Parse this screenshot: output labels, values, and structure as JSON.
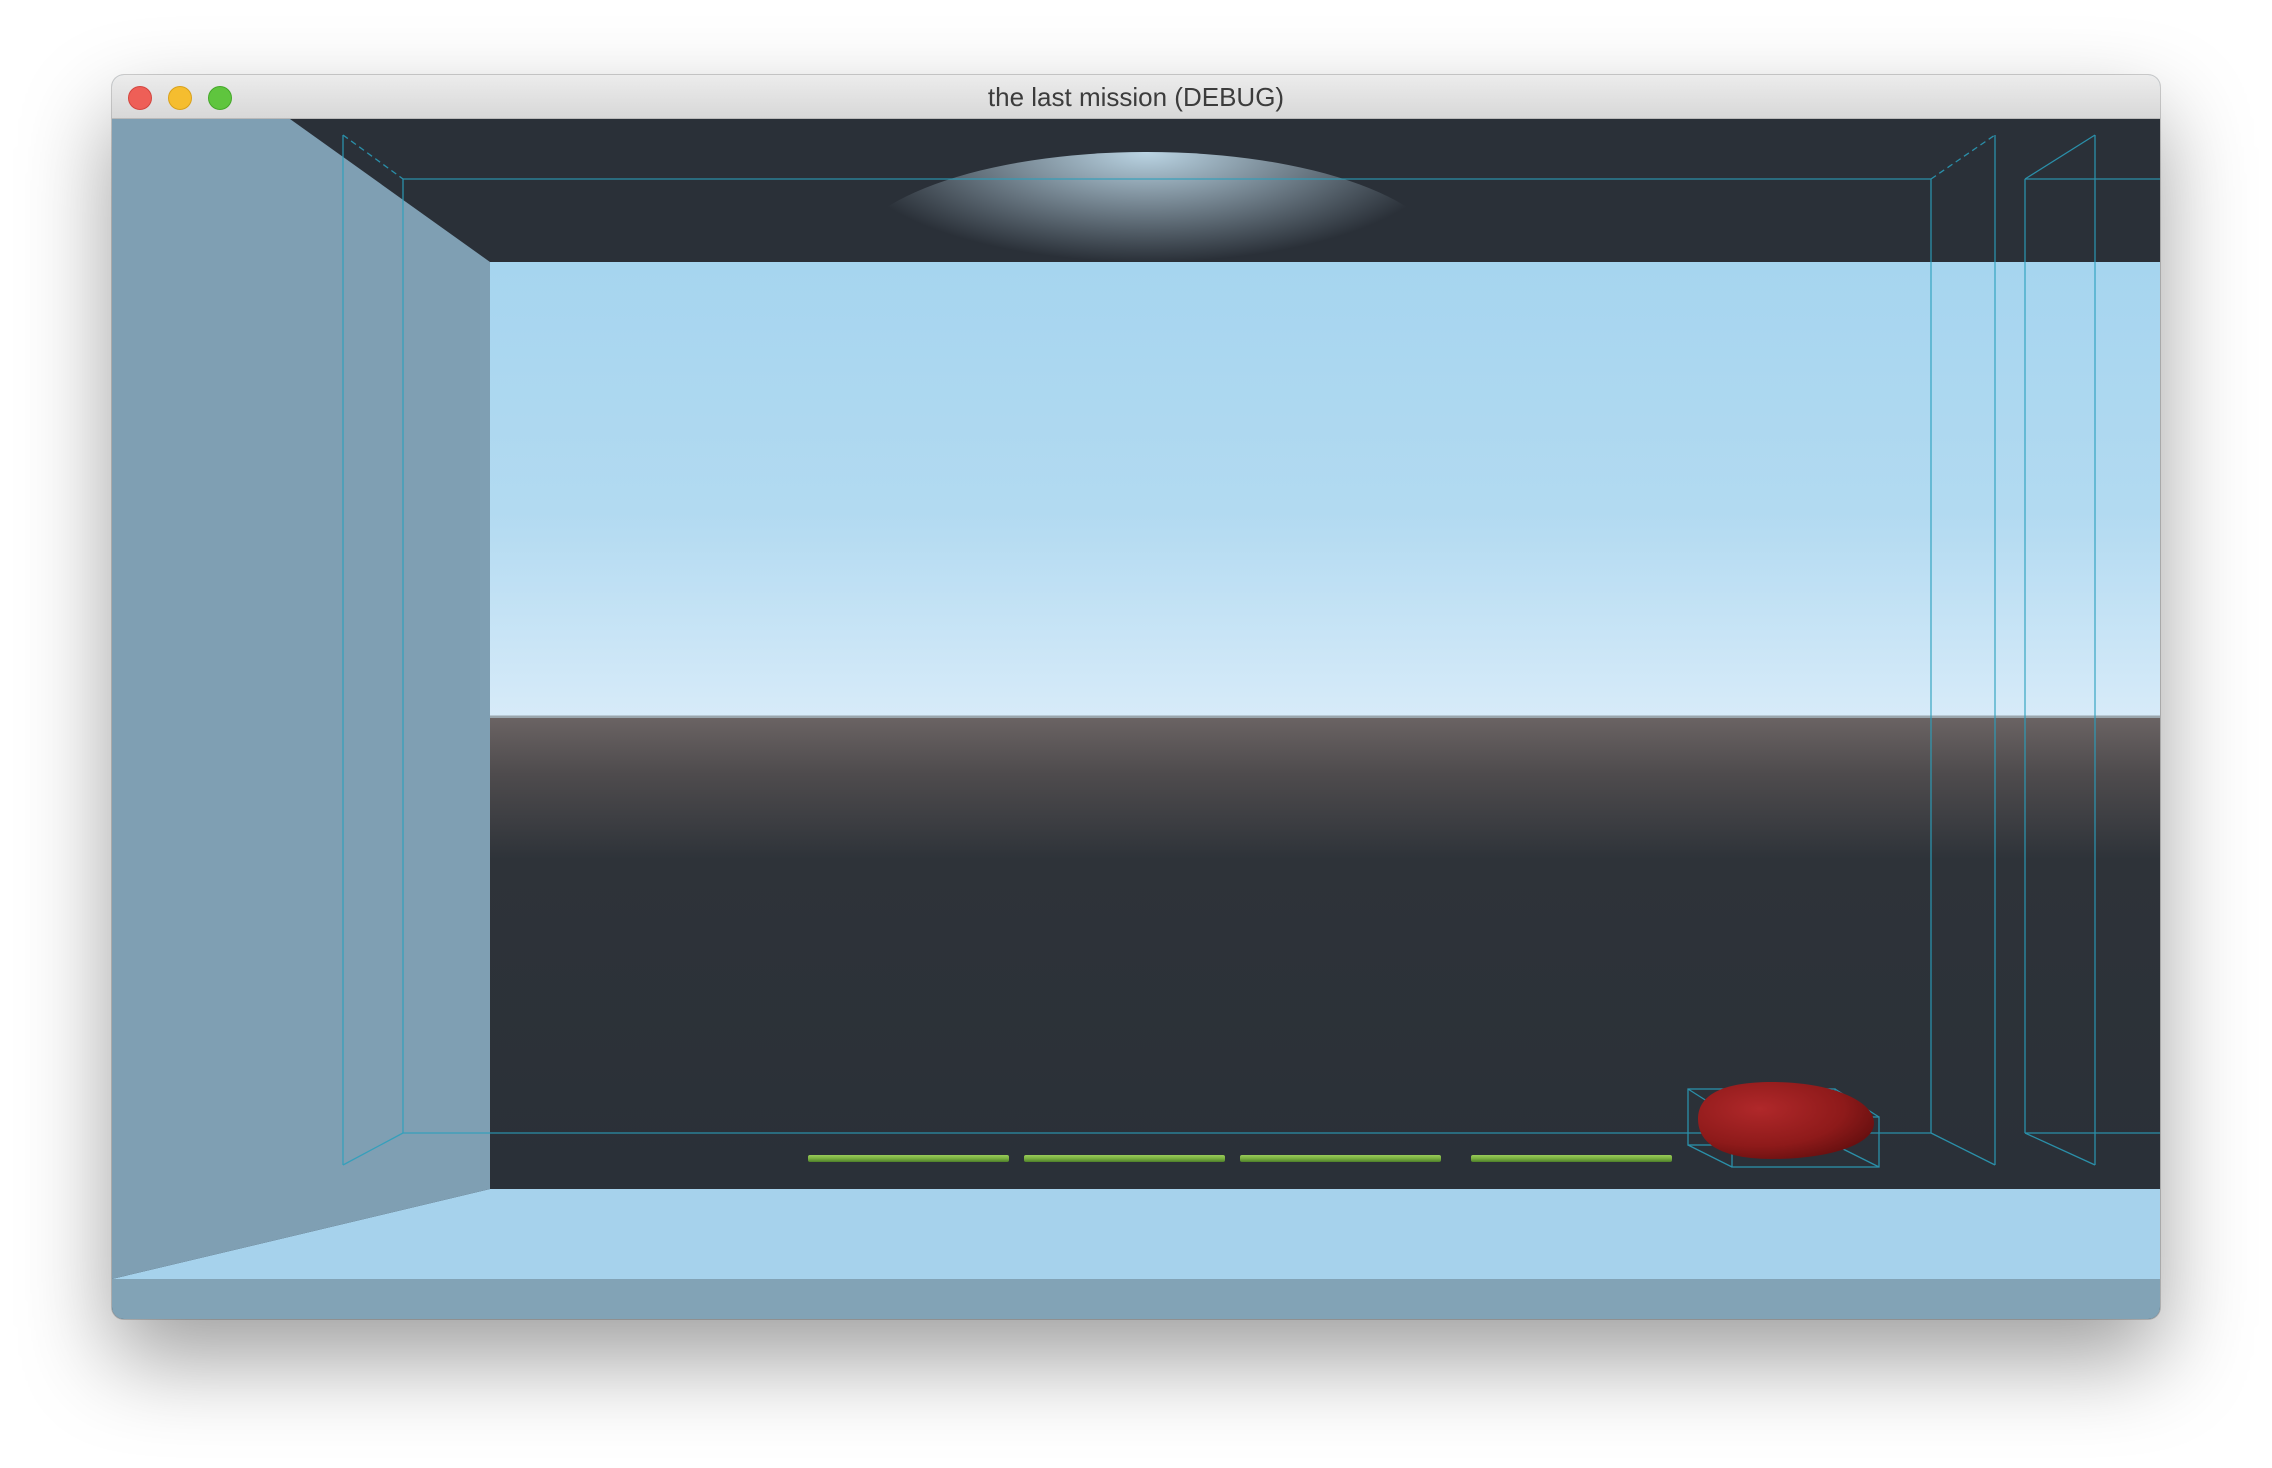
{
  "window": {
    "title": "the last mission (DEBUG)",
    "controls": [
      "close",
      "minimize",
      "maximize"
    ]
  },
  "scene": {
    "colors": {
      "sky_top": "#a6d5ef",
      "sky_horizon": "#d7ebf9",
      "ground_far": "#5c5656",
      "ground_near": "#2a3038",
      "ceiling": "#2a3038",
      "side_wall": "#7f9fb3",
      "floor": "#a6d2ec",
      "debug_lines": "#2aa0bd",
      "platform_green": "#7ab040",
      "player_red": "#8e1a1a"
    },
    "objects": [
      "left-wall",
      "floor",
      "sky-panel",
      "horizon-ground",
      "platform-1",
      "platform-2",
      "platform-3",
      "platform-4",
      "player-capsule"
    ]
  }
}
